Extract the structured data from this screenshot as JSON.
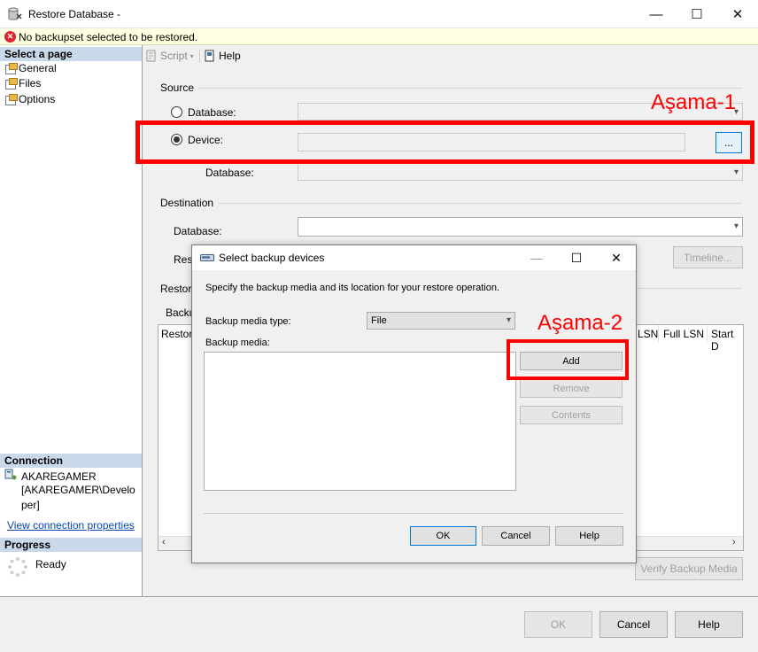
{
  "window": {
    "title": "Restore Database -",
    "controls": {
      "minimize": "—",
      "maximize": "☐",
      "close": "✕"
    }
  },
  "warning": {
    "message": "No backupset selected to be restored.",
    "icon": "error-icon"
  },
  "left_pane": {
    "select_page_header": "Select a page",
    "pages": [
      "General",
      "Files",
      "Options"
    ],
    "connection_header": "Connection",
    "connection_server": "AKAREGAMER",
    "connection_user_line1": "[AKAREGAMER\\Develo",
    "connection_user_line2": "per]",
    "view_connection_link": "View connection properties",
    "progress_header": "Progress",
    "progress_status": "Ready"
  },
  "toolbar": {
    "script_label": "Script",
    "help_label": "Help"
  },
  "source": {
    "label": "Source",
    "database_radio": "Database:",
    "device_radio": "Device:",
    "device_value": "",
    "browse_label": "...",
    "database_label": "Database:"
  },
  "destination": {
    "label": "Destination",
    "database_label": "Database:",
    "restore_to_partial": "Rest",
    "timeline_button": "Timeline..."
  },
  "restore_plan": {
    "label_partial": "Restore",
    "backup_sets_partial": "Backu",
    "grid_columns": [
      "Restore",
      "LSN",
      "Full LSN",
      "Start D"
    ],
    "verify_button": "Verify Backup Media"
  },
  "annotations": {
    "stage1": "Aşama-1",
    "stage2": "Aşama-2"
  },
  "dialog": {
    "title": "Select backup devices",
    "description": "Specify the backup media and its location for your restore operation.",
    "media_type_label": "Backup media type:",
    "media_type_value": "File",
    "media_label": "Backup media:",
    "add_button": "Add",
    "remove_button": "Remove",
    "contents_button": "Contents",
    "ok_button": "OK",
    "cancel_button": "Cancel",
    "help_button": "Help"
  },
  "footer": {
    "ok_button": "OK",
    "cancel_button": "Cancel",
    "help_button": "Help"
  }
}
